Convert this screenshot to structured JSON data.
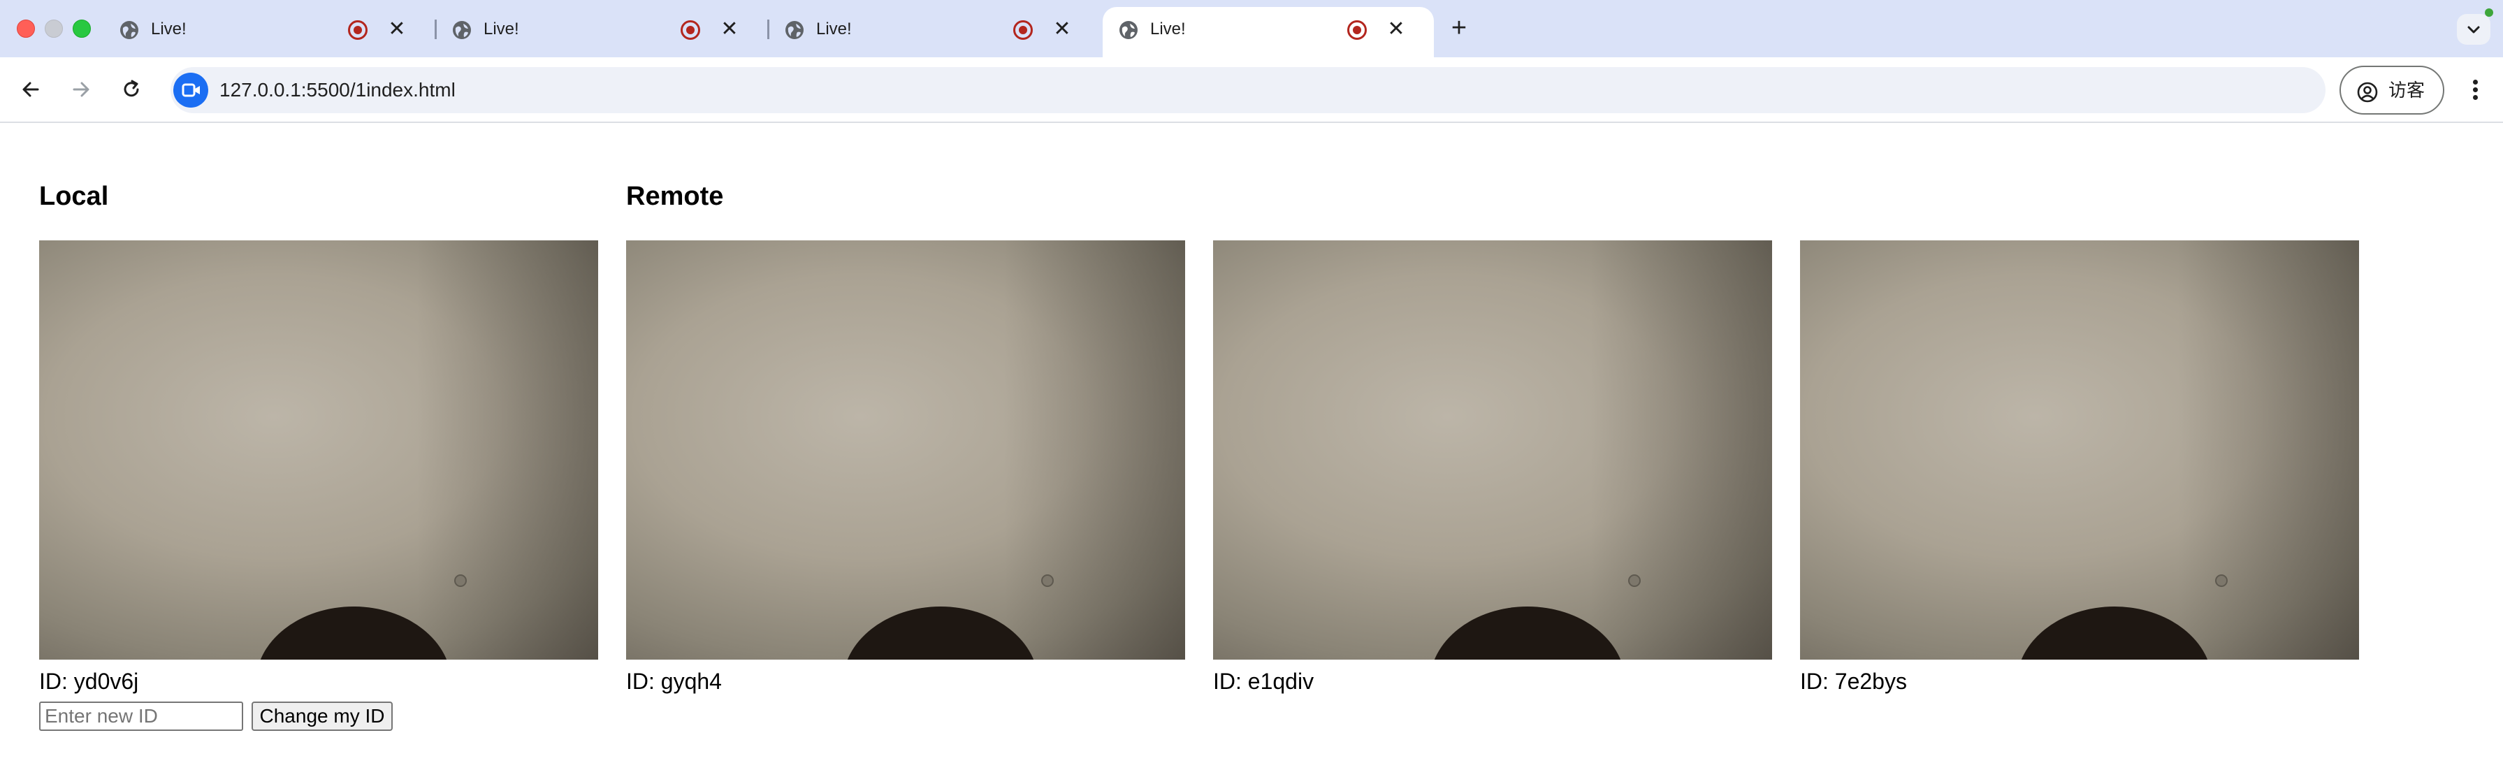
{
  "browser": {
    "tabs": [
      {
        "title": "Live!",
        "favicon": "globe-icon",
        "recording": true,
        "active": false
      },
      {
        "title": "Live!",
        "favicon": "globe-icon",
        "recording": true,
        "active": false
      },
      {
        "title": "Live!",
        "favicon": "globe-icon",
        "recording": true,
        "active": false
      },
      {
        "title": "Live!",
        "favicon": "globe-icon",
        "recording": true,
        "active": true
      }
    ],
    "address": "127.0.0.1:5500/1index.html",
    "profile_label": "访客",
    "accent_color": "#1b6ef3",
    "recording_color": "#b3261e"
  },
  "page": {
    "local": {
      "heading": "Local",
      "video": {
        "id_text": "ID: yd0v6j"
      },
      "input_placeholder": "Enter new ID",
      "change_button": "Change my ID"
    },
    "remote": {
      "heading": "Remote",
      "videos": [
        {
          "id_text": "ID: gyqh4"
        },
        {
          "id_text": "ID: e1qdiv"
        },
        {
          "id_text": "ID: 7e2bys"
        }
      ]
    }
  }
}
